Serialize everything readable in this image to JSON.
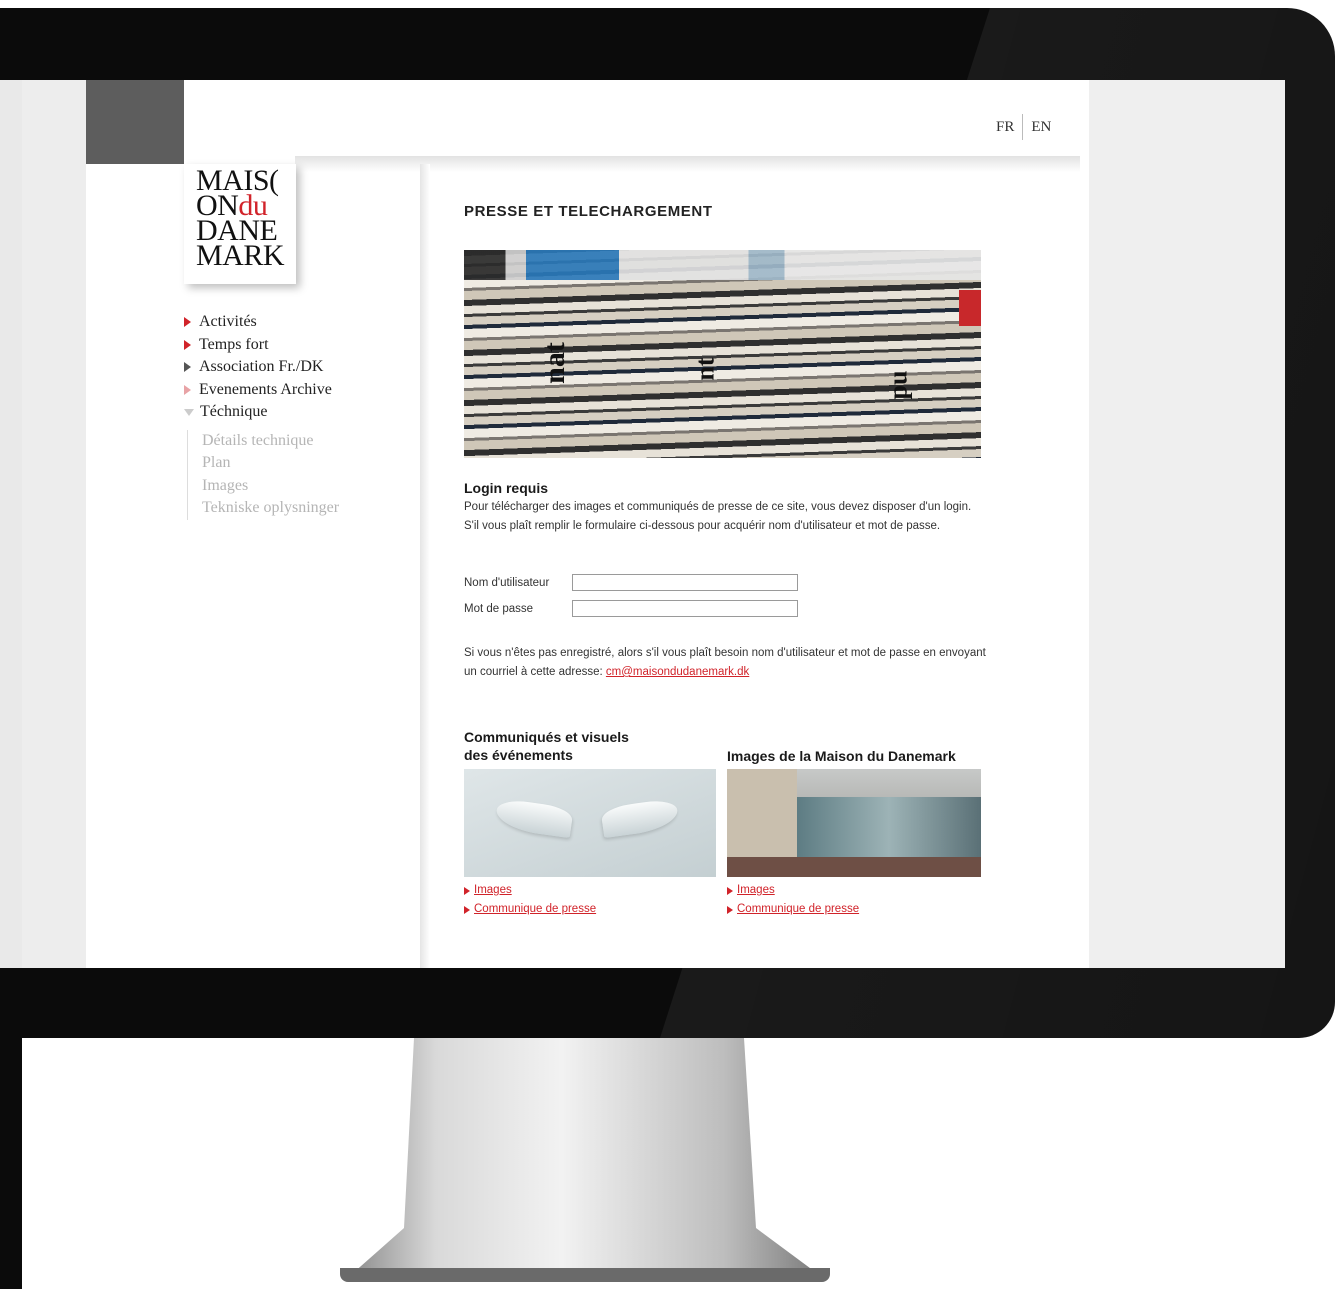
{
  "lang": {
    "fr": "FR",
    "en": "EN"
  },
  "logo": {
    "line1": "MAIS(",
    "line2a": "ON",
    "line2b": "du",
    "line3": "DANE",
    "line4": "MARK"
  },
  "nav": {
    "items": [
      {
        "label": "Activités"
      },
      {
        "label": "Temps fort"
      },
      {
        "label": "Association Fr./DK"
      },
      {
        "label": "Evenements Archive"
      },
      {
        "label": "Téchnique"
      }
    ],
    "subitems": [
      {
        "label": "Détails technique"
      },
      {
        "label": "Plan"
      },
      {
        "label": "Images"
      },
      {
        "label": "Tekniske oplysninger"
      }
    ]
  },
  "main": {
    "title": "PRESSE ET TELECHARGEMENT",
    "login_heading": "Login requis",
    "login_text": "Pour télécharger des images et communiqués de presse de ce site, vous devez disposer d'un login. S'il vous plaît remplir le formulaire ci-dessous pour acquérir nom d'utilisateur et mot de passe.",
    "username_label": "Nom d'utilisateur",
    "password_label": "Mot de passe",
    "register_text": "Si vous n'êtes pas enregistré, alors s'il vous plaît besoin nom d'utilisateur et mot de passe en envoyant un courriel à cette adresse:",
    "email": "cm@maisondudanemark.dk",
    "col1_heading_1": "Communiqués et visuels",
    "col1_heading_2": "des événements",
    "col2_heading": "Images de la Maison du Danemark",
    "link_images": "Images",
    "link_press": "Communique de presse"
  }
}
